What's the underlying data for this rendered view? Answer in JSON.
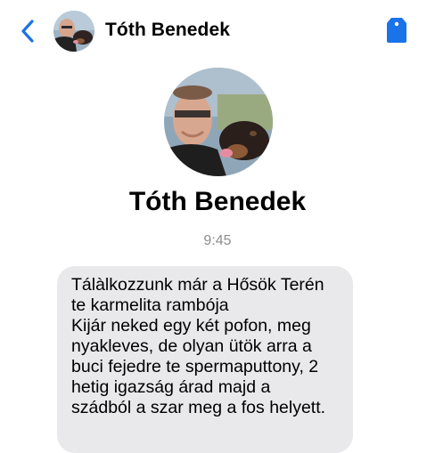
{
  "header": {
    "contact_name": "Tóth Benedek",
    "back_icon": "chevron-left-icon",
    "tag_icon": "tag-icon",
    "accent_color": "#1a73e8"
  },
  "profile": {
    "name": "Tóth Benedek"
  },
  "conversation": {
    "timestamp": "9:45",
    "message_lines": [
      "Tálàlkozzunk már a Hősök Terén",
      "te karmelita rambója",
      "Kijár neked egy két pofon, meg",
      "nyakleves, de olyan ütök arra a",
      "buci fejedre te spermaputtony, 2",
      "hetig igazság árad majd a",
      "szádból a szar meg a fos helyett."
    ],
    "bubble_color": "#e9e9eb"
  }
}
